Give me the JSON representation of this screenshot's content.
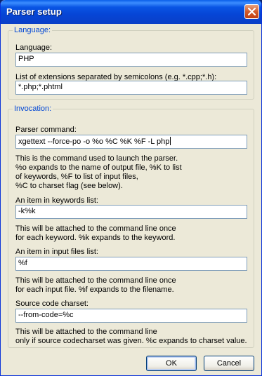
{
  "window": {
    "title": "Parser setup",
    "close_icon": "close-icon"
  },
  "language_group": {
    "legend": "Language:",
    "language_label": "Language:",
    "language_value": "PHP",
    "extensions_label": "List of extensions separated by semicolons (e.g. *.cpp;*.h):",
    "extensions_value": "*.php;*.phtml"
  },
  "invocation_group": {
    "legend": "Invocation:",
    "command_label": "Parser command:",
    "command_value": "xgettext --force-po -o %o %C %K %F -L php",
    "command_help": [
      "This is the command used to launch the parser.",
      "%o expands to the name of output file, %K to list",
      "of keywords, %F to list of input files,",
      "%C to charset flag (see below)."
    ],
    "keywords_label": "An item in keywords list:",
    "keywords_value": "-k%k",
    "keywords_help": [
      "This will be attached to the command line once",
      "for each keyword. %k expands to the keyword."
    ],
    "inputfiles_label": "An item in input files list:",
    "inputfiles_value": "%f",
    "inputfiles_help": [
      "This will be attached to the command line once",
      "for each input file. %f expands to the filename."
    ],
    "charset_label": "Source code charset:",
    "charset_value": "--from-code=%c",
    "charset_help": [
      "This will be attached to the command line",
      "only if source codecharset was given. %c expands to charset value."
    ]
  },
  "buttons": {
    "ok": "OK",
    "cancel": "Cancel"
  }
}
